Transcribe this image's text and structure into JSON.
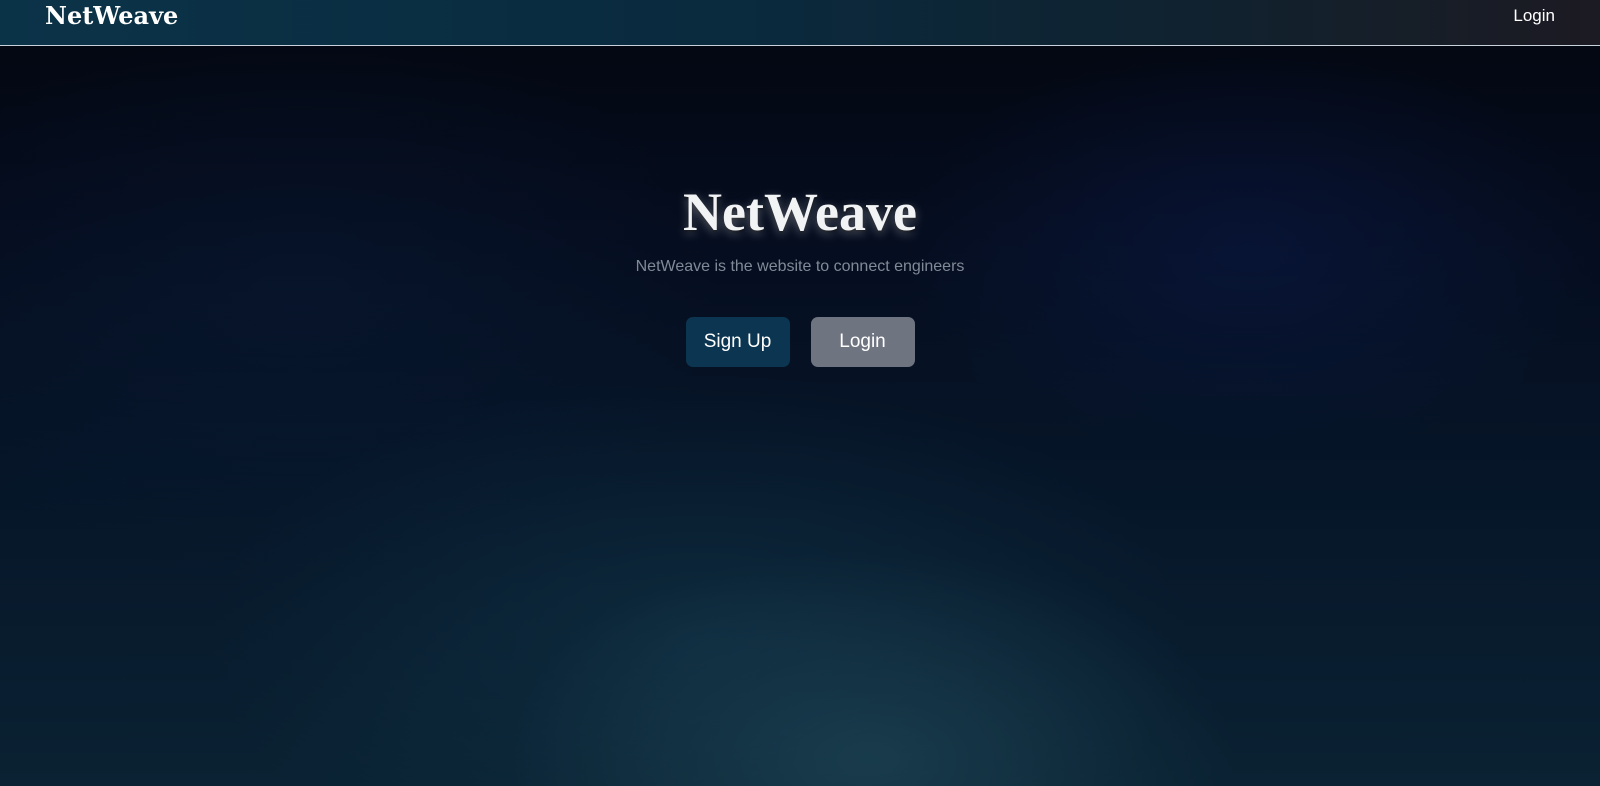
{
  "navbar": {
    "brand": "NetWeave",
    "login_label": "Login"
  },
  "hero": {
    "title": "NetWeave",
    "subtitle": "NetWeave is the website to connect engineers",
    "signup_label": "Sign Up",
    "login_label": "Login"
  },
  "colors": {
    "navbar_start": "#0b3348",
    "signup_button": "#0b3550",
    "login_button": "#6e7480",
    "subtitle_text": "#808a96"
  }
}
